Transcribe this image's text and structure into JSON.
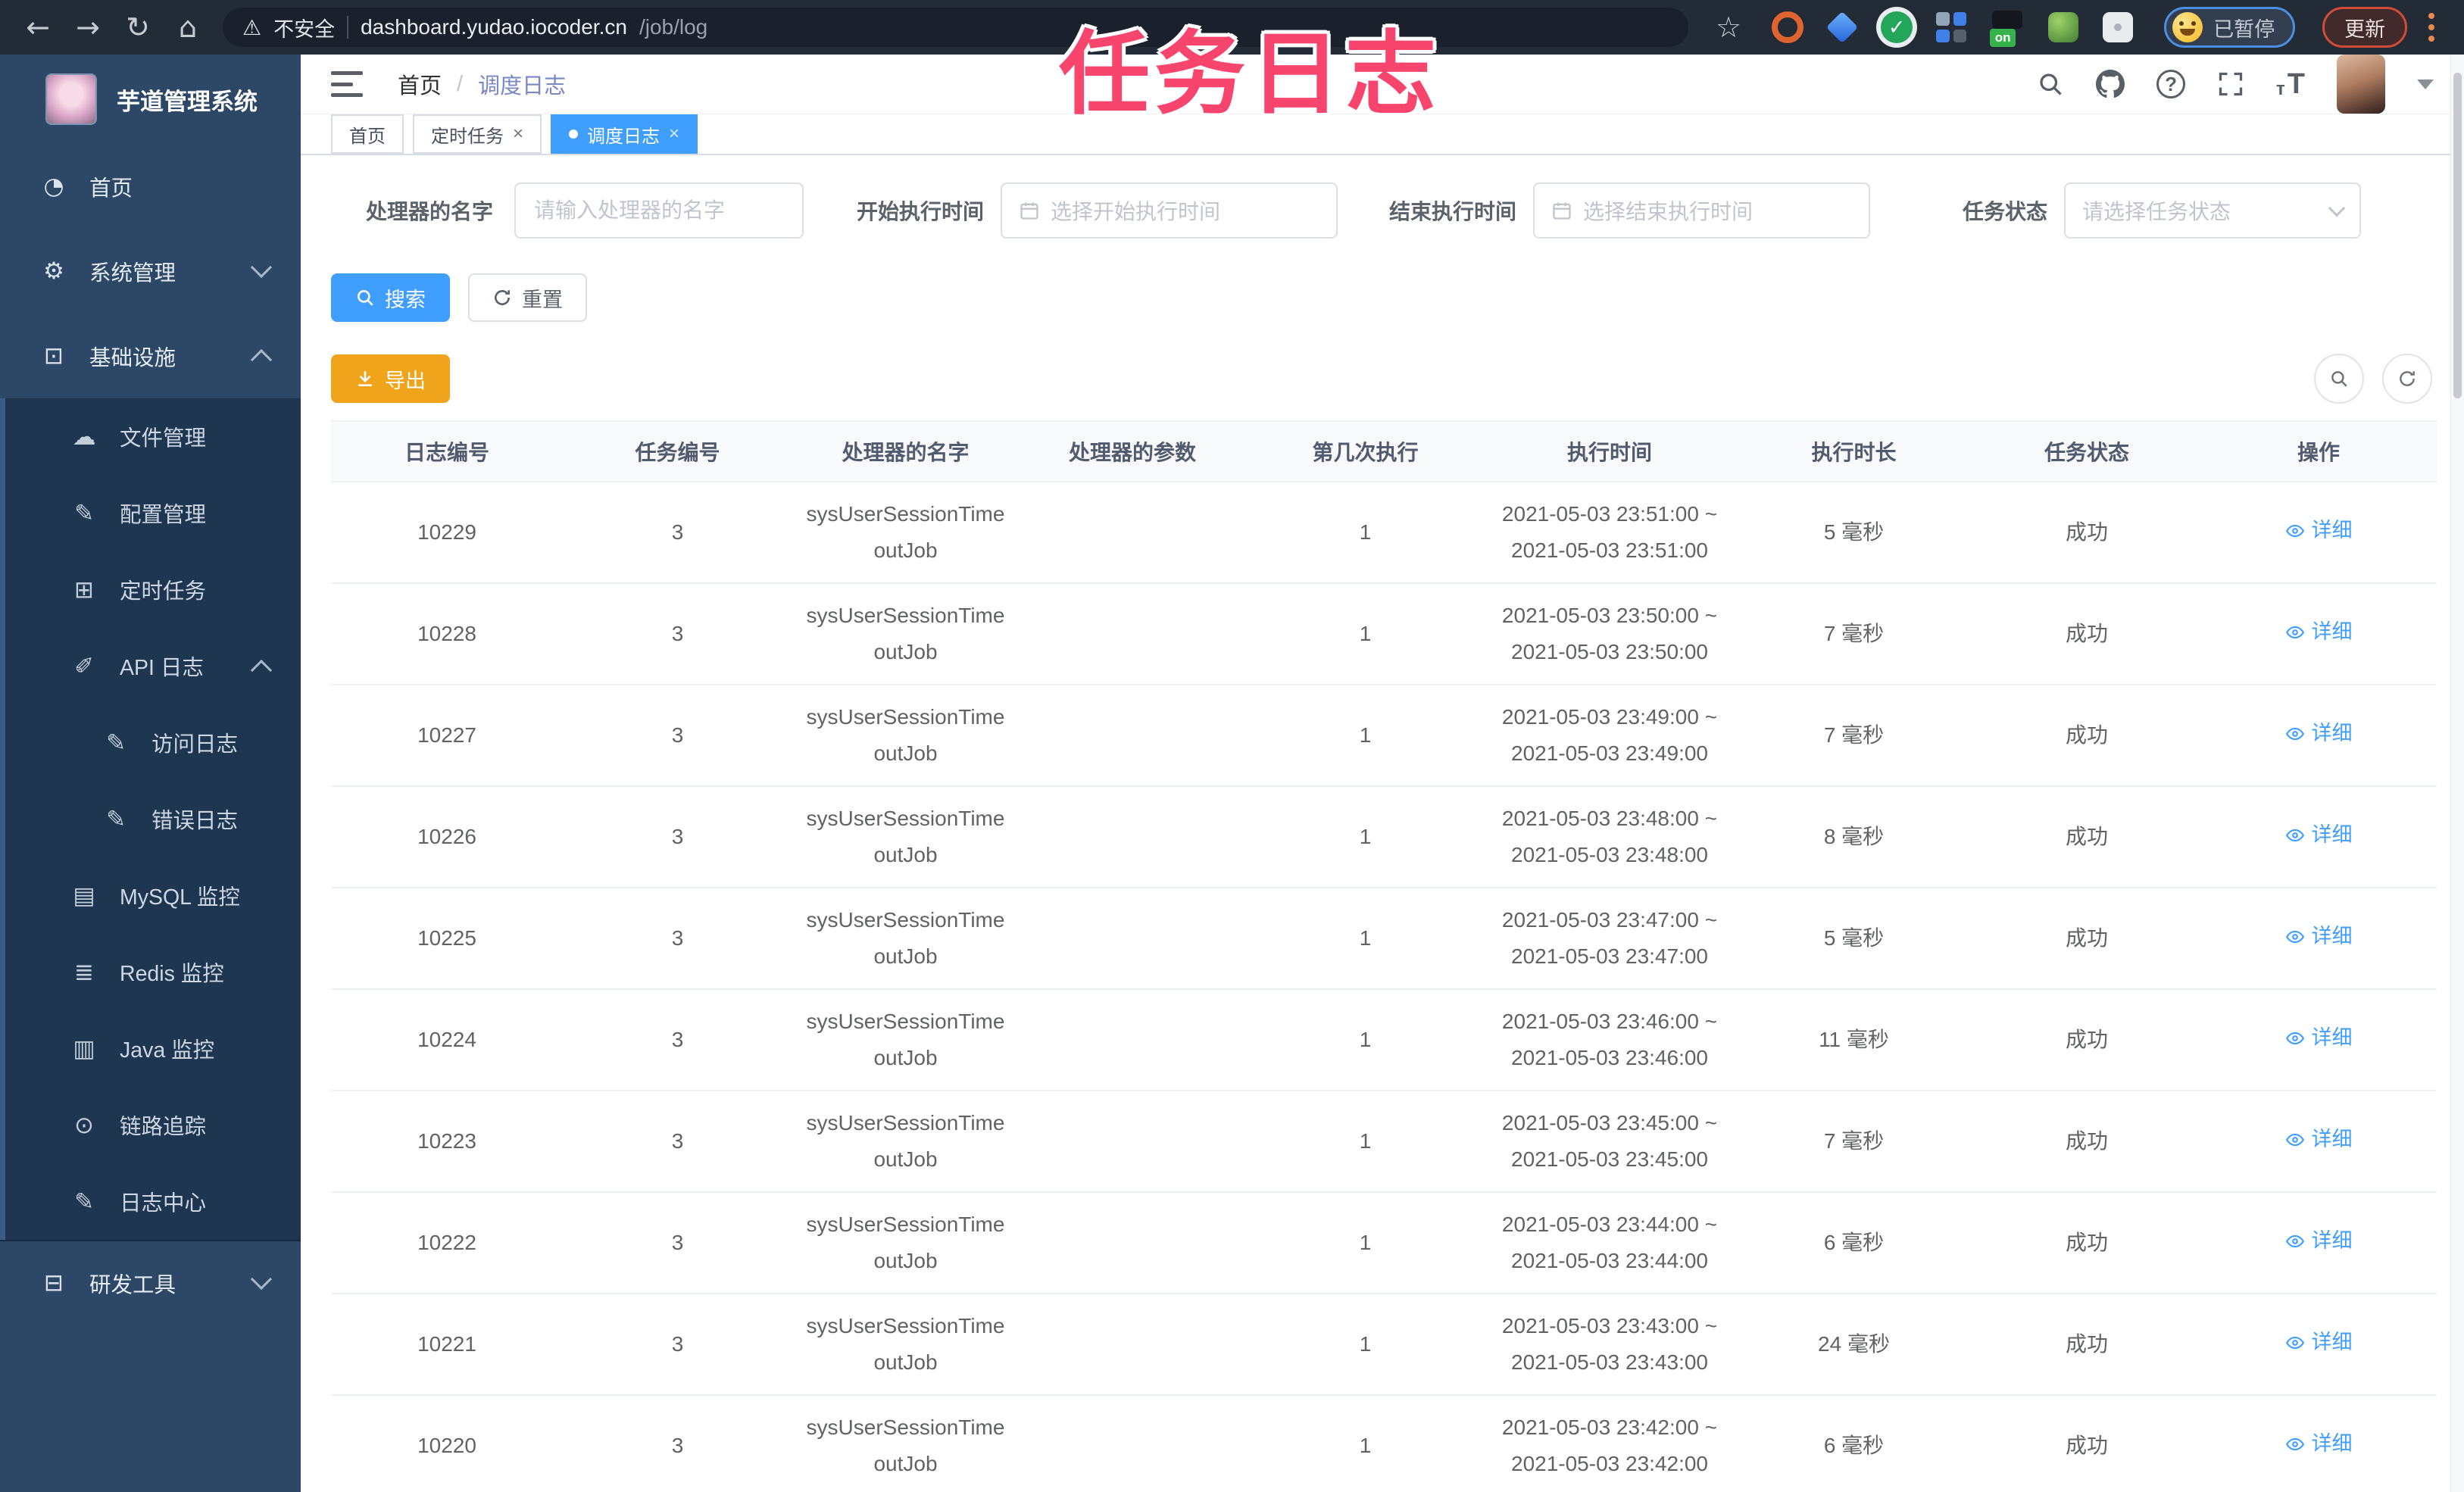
{
  "colors": {
    "accent": "#409EFF",
    "warning_button": "#F0A41C",
    "annotation_pink": "#F8456E",
    "chrome_bg": "#232B37",
    "sidebar_bg": "#2C4866",
    "submenu_bg": "#1F3650",
    "profile_ring_blue": "#4B8FE2",
    "update_ring_red": "#D14B39",
    "breadcrumb_current": "#7987C6",
    "link_blue": "#409EFF"
  },
  "annotation": {
    "text": "任务日志"
  },
  "browser": {
    "nav_icons": [
      "back-arrow",
      "forward-arrow",
      "reload",
      "home"
    ],
    "security_label": "不安全",
    "url_host": "dashboard.yudao.iocoder.cn",
    "url_path": "/job/log",
    "bookmark_icon": "star",
    "extension_icons": [
      "orange-ring-extension",
      "blue-gem-extension",
      "green-check-extension",
      "grid-extension",
      "on-badge-extension",
      "green-leaf-extension",
      "puzzle-extension"
    ],
    "on_badge_text": "on",
    "profile_chip_label": "已暂停",
    "update_label": "更新",
    "menu_icon": "kebab-menu"
  },
  "sidebar": {
    "app_title": "芋道管理系统",
    "items": [
      {
        "label": "首页",
        "icon": "dashboard-icon",
        "glyph": "◔",
        "level": "top"
      },
      {
        "label": "系统管理",
        "icon": "gear-icon",
        "glyph": "⚙",
        "level": "top",
        "arrow": "down"
      },
      {
        "label": "基础设施",
        "icon": "monitor-icon",
        "glyph": "⊡",
        "level": "top",
        "arrow": "up"
      },
      {
        "label": "文件管理",
        "icon": "cloud-upload-icon",
        "glyph": "☁",
        "level": "sub"
      },
      {
        "label": "配置管理",
        "icon": "edit-square-icon",
        "glyph": "✎",
        "level": "sub"
      },
      {
        "label": "定时任务",
        "icon": "timer-icon",
        "glyph": "⊞",
        "level": "sub"
      },
      {
        "label": "API 日志",
        "icon": "api-log-icon",
        "glyph": "✐",
        "level": "sub",
        "arrow": "up"
      },
      {
        "label": "访问日志",
        "icon": "access-log-icon",
        "glyph": "✎",
        "level": "subsub"
      },
      {
        "label": "错误日志",
        "icon": "error-log-icon",
        "glyph": "✎",
        "level": "subsub"
      },
      {
        "label": "MySQL 监控",
        "icon": "mysql-monitor-icon",
        "glyph": "▤",
        "level": "sub"
      },
      {
        "label": "Redis 监控",
        "icon": "redis-monitor-icon",
        "glyph": "≣",
        "level": "sub"
      },
      {
        "label": "Java 监控",
        "icon": "java-monitor-icon",
        "glyph": "▥",
        "level": "sub"
      },
      {
        "label": "链路追踪",
        "icon": "trace-eye-icon",
        "glyph": "⊙",
        "level": "sub"
      },
      {
        "label": "日志中心",
        "icon": "log-center-icon",
        "glyph": "✎",
        "level": "sub"
      },
      {
        "label": "研发工具",
        "icon": "toolbox-icon",
        "glyph": "⊟",
        "level": "top2",
        "arrow": "down"
      }
    ]
  },
  "header": {
    "menu_icon": "hamburger",
    "breadcrumb_home": "首页",
    "breadcrumb_sep": "/",
    "breadcrumb_current": "调度日志",
    "icon_names": [
      "search-icon",
      "github-icon",
      "help-icon",
      "fullscreen-icon",
      "font-size-icon",
      "avatar",
      "caret-down-icon"
    ],
    "help_glyph": "?"
  },
  "tabs": [
    {
      "label": "首页",
      "closable": false,
      "active": false
    },
    {
      "label": "定时任务",
      "closable": true,
      "active": false
    },
    {
      "label": "调度日志",
      "closable": true,
      "active": true
    }
  ],
  "filters": {
    "handler_label": "处理器的名字",
    "handler_placeholder": "请输入处理器的名字",
    "start_label": "开始执行时间",
    "start_placeholder": "选择开始执行时间",
    "end_label": "结束执行时间",
    "end_placeholder": "选择结束执行时间",
    "status_label": "任务状态",
    "status_placeholder": "请选择任务状态"
  },
  "toolbar": {
    "search_label": "搜索",
    "reset_label": "重置",
    "export_label": "导出",
    "table_icons": [
      "show-search-toggle-icon",
      "refresh-table-icon"
    ]
  },
  "table": {
    "headers": [
      "日志编号",
      "任务编号",
      "处理器的名字",
      "处理器的参数",
      "第几次执行",
      "执行时间",
      "执行时长",
      "任务状态",
      "操作"
    ],
    "action_label": "详细",
    "rows": [
      {
        "id": "10229",
        "job_id": "3",
        "handler": "sysUserSessionTimeoutJob",
        "param": "",
        "count": "1",
        "time": [
          "2021-05-03 23:51:00 ~",
          "2021-05-03 23:51:00"
        ],
        "duration": "5 毫秒",
        "status": "成功"
      },
      {
        "id": "10228",
        "job_id": "3",
        "handler": "sysUserSessionTimeoutJob",
        "param": "",
        "count": "1",
        "time": [
          "2021-05-03 23:50:00 ~",
          "2021-05-03 23:50:00"
        ],
        "duration": "7 毫秒",
        "status": "成功"
      },
      {
        "id": "10227",
        "job_id": "3",
        "handler": "sysUserSessionTimeoutJob",
        "param": "",
        "count": "1",
        "time": [
          "2021-05-03 23:49:00 ~",
          "2021-05-03 23:49:00"
        ],
        "duration": "7 毫秒",
        "status": "成功"
      },
      {
        "id": "10226",
        "job_id": "3",
        "handler": "sysUserSessionTimeoutJob",
        "param": "",
        "count": "1",
        "time": [
          "2021-05-03 23:48:00 ~",
          "2021-05-03 23:48:00"
        ],
        "duration": "8 毫秒",
        "status": "成功"
      },
      {
        "id": "10225",
        "job_id": "3",
        "handler": "sysUserSessionTimeoutJob",
        "param": "",
        "count": "1",
        "time": [
          "2021-05-03 23:47:00 ~",
          "2021-05-03 23:47:00"
        ],
        "duration": "5 毫秒",
        "status": "成功"
      },
      {
        "id": "10224",
        "job_id": "3",
        "handler": "sysUserSessionTimeoutJob",
        "param": "",
        "count": "1",
        "time": [
          "2021-05-03 23:46:00 ~",
          "2021-05-03 23:46:00"
        ],
        "duration": "11 毫秒",
        "status": "成功"
      },
      {
        "id": "10223",
        "job_id": "3",
        "handler": "sysUserSessionTimeoutJob",
        "param": "",
        "count": "1",
        "time": [
          "2021-05-03 23:45:00 ~",
          "2021-05-03 23:45:00"
        ],
        "duration": "7 毫秒",
        "status": "成功"
      },
      {
        "id": "10222",
        "job_id": "3",
        "handler": "sysUserSessionTimeoutJob",
        "param": "",
        "count": "1",
        "time": [
          "2021-05-03 23:44:00 ~",
          "2021-05-03 23:44:00"
        ],
        "duration": "6 毫秒",
        "status": "成功"
      },
      {
        "id": "10221",
        "job_id": "3",
        "handler": "sysUserSessionTimeoutJob",
        "param": "",
        "count": "1",
        "time": [
          "2021-05-03 23:43:00 ~",
          "2021-05-03 23:43:00"
        ],
        "duration": "24 毫秒",
        "status": "成功"
      },
      {
        "id": "10220",
        "job_id": "3",
        "handler": "sysUserSessionTimeoutJob",
        "param": "",
        "count": "1",
        "time": [
          "2021-05-03 23:42:00 ~",
          "2021-05-03 23:42:00"
        ],
        "duration": "6 毫秒",
        "status": "成功"
      }
    ]
  }
}
